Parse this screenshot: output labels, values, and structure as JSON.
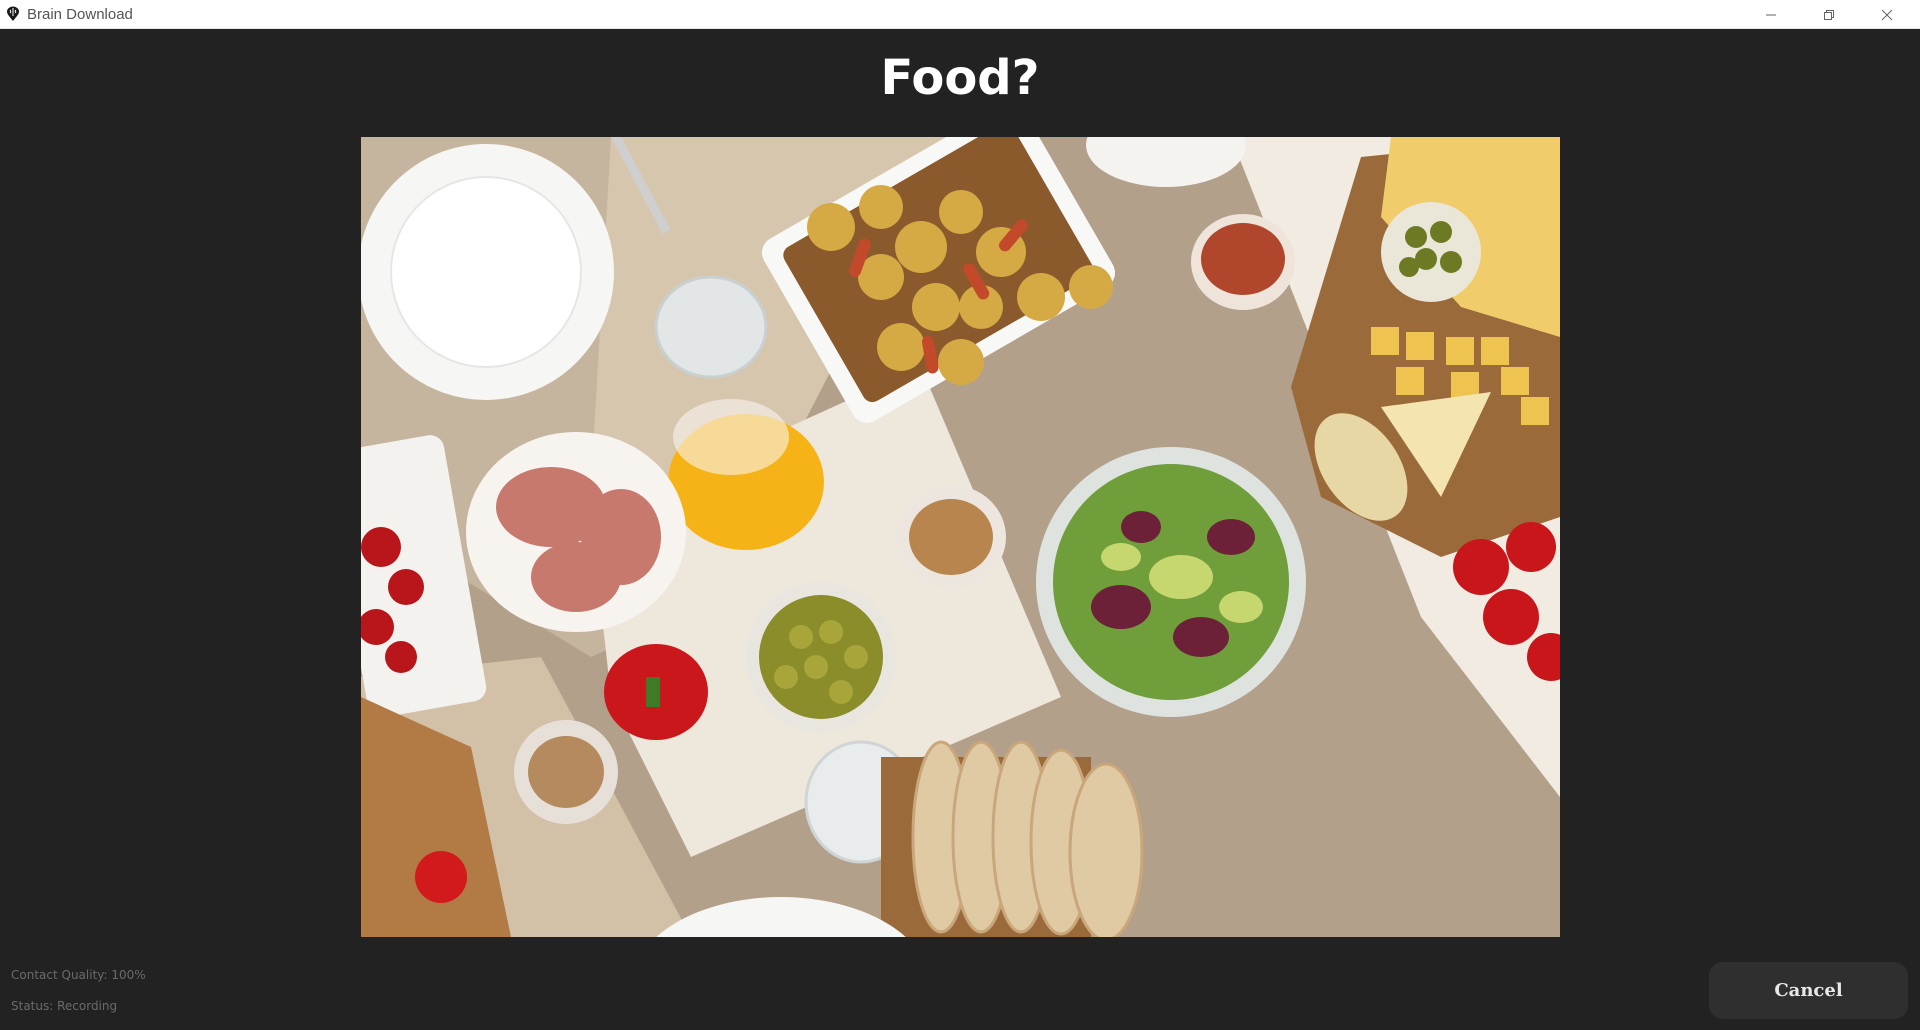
{
  "window": {
    "title": "Brain Download",
    "app_icon": "brain-pin-icon",
    "controls": [
      "minimize-icon",
      "restore-icon",
      "close-icon"
    ]
  },
  "prompt": {
    "question": "Food?"
  },
  "stimulus_image": {
    "description_icon": "food-table-photo"
  },
  "status": {
    "contact_quality": "Contact Quality: 100%",
    "state": "Status: Recording"
  },
  "actions": {
    "cancel_label": "Cancel"
  },
  "colors": {
    "background": "#222222",
    "titlebar": "#ffffff",
    "button": "#2f2f2f",
    "status_text": "#6a6a6a"
  }
}
